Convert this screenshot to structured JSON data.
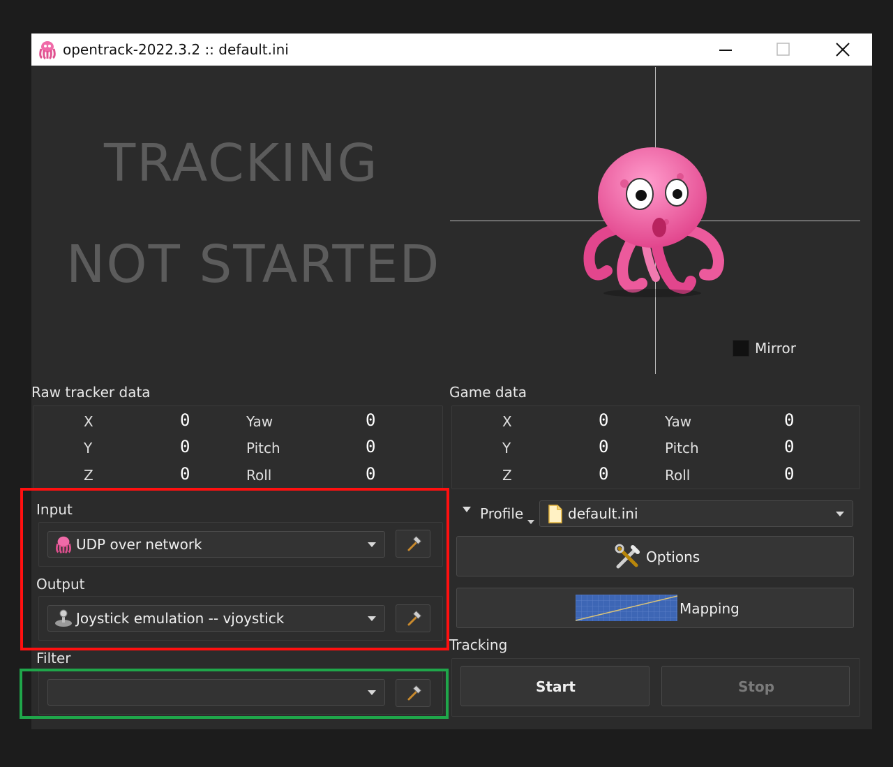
{
  "window": {
    "title": "opentrack-2022.3.2 :: default.ini",
    "controls": {
      "minimize": "minimize-icon",
      "maximize": "maximize-icon",
      "close": "close-icon"
    }
  },
  "status": {
    "line1": "TRACKING",
    "line2": "NOT STARTED"
  },
  "preview": {
    "mirror_label": "Mirror",
    "mirror_checked": false
  },
  "raw_tracker": {
    "title": "Raw tracker data",
    "rows": [
      {
        "axis": "X",
        "axis_value": "0",
        "rot": "Yaw",
        "rot_value": "0"
      },
      {
        "axis": "Y",
        "axis_value": "0",
        "rot": "Pitch",
        "rot_value": "0"
      },
      {
        "axis": "Z",
        "axis_value": "0",
        "rot": "Roll",
        "rot_value": "0"
      }
    ]
  },
  "game_data": {
    "title": "Game data",
    "rows": [
      {
        "axis": "X",
        "axis_value": "0",
        "rot": "Yaw",
        "rot_value": "0"
      },
      {
        "axis": "Y",
        "axis_value": "0",
        "rot": "Pitch",
        "rot_value": "0"
      },
      {
        "axis": "Z",
        "axis_value": "0",
        "rot": "Roll",
        "rot_value": "0"
      }
    ]
  },
  "modules": {
    "input_label": "Input",
    "input_value": "UDP over network",
    "output_label": "Output",
    "output_value": "Joystick emulation -- vjoystick",
    "filter_label": "Filter",
    "filter_value": ""
  },
  "profile": {
    "label": "Profile",
    "value": "default.ini"
  },
  "buttons": {
    "options": "Options",
    "mapping": "Mapping",
    "start": "Start",
    "stop": "Stop"
  },
  "tracking_label": "Tracking",
  "colors": {
    "highlight_red": "#ff1010",
    "highlight_green": "#1fa64a",
    "octopus_pink": "#f06aa8"
  }
}
